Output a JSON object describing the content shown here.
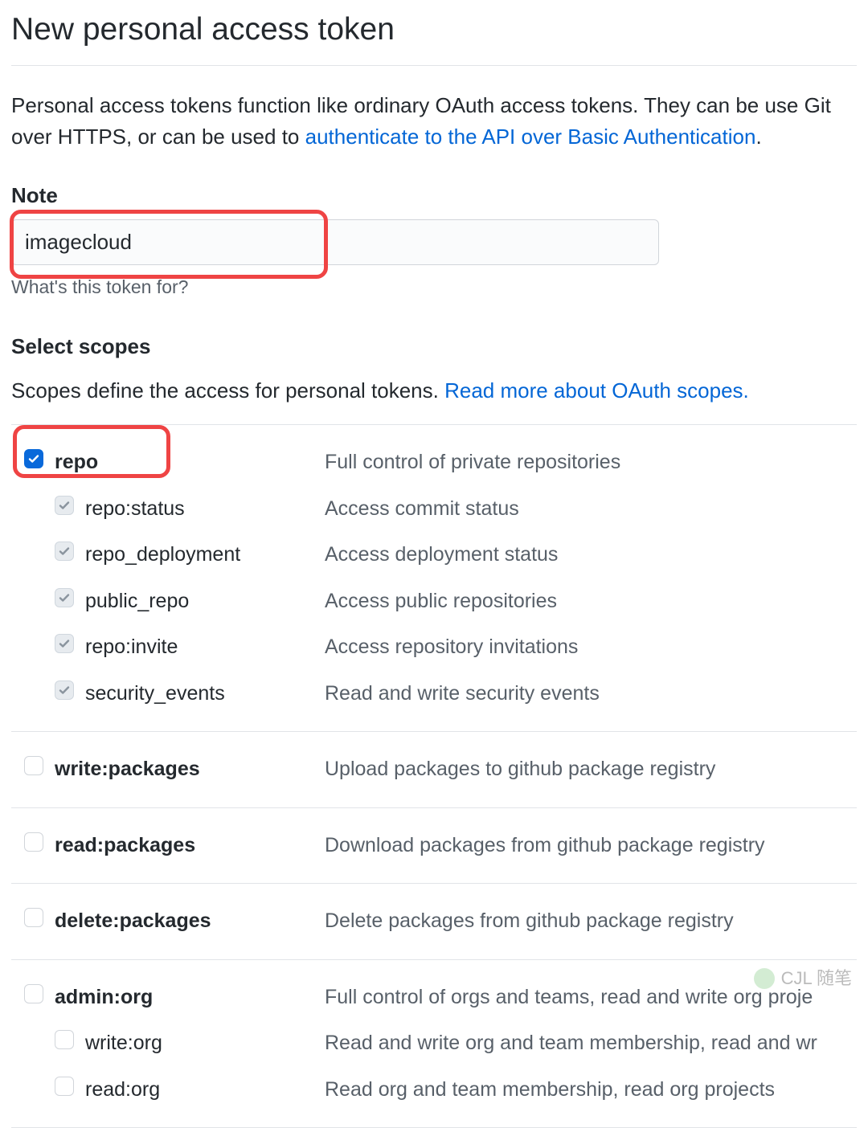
{
  "title": "New personal access token",
  "intro_prefix": "Personal access tokens function like ordinary OAuth access tokens. They can be use Git over HTTPS, or can be used to ",
  "intro_link": "authenticate to the API over Basic Authentication",
  "intro_suffix": ".",
  "note_label": "Note",
  "note_value": "imagecloud",
  "note_hint": "What's this token for?",
  "select_scopes_label": "Select scopes",
  "scopes_intro_prefix": "Scopes define the access for personal tokens. ",
  "scopes_intro_link": "Read more about OAuth scopes.",
  "scopes": [
    {
      "name": "repo",
      "desc": "Full control of private repositories",
      "checked": true,
      "primary": true,
      "highlight": true,
      "children": [
        {
          "name": "repo:status",
          "desc": "Access commit status",
          "checked": true
        },
        {
          "name": "repo_deployment",
          "desc": "Access deployment status",
          "checked": true
        },
        {
          "name": "public_repo",
          "desc": "Access public repositories",
          "checked": true
        },
        {
          "name": "repo:invite",
          "desc": "Access repository invitations",
          "checked": true
        },
        {
          "name": "security_events",
          "desc": "Read and write security events",
          "checked": true
        }
      ]
    },
    {
      "name": "write:packages",
      "desc": "Upload packages to github package registry",
      "checked": false,
      "children": []
    },
    {
      "name": "read:packages",
      "desc": "Download packages from github package registry",
      "checked": false,
      "children": []
    },
    {
      "name": "delete:packages",
      "desc": "Delete packages from github package registry",
      "checked": false,
      "children": []
    },
    {
      "name": "admin:org",
      "desc": "Full control of orgs and teams, read and write org proje",
      "checked": false,
      "children": [
        {
          "name": "write:org",
          "desc": "Read and write org and team membership, read and wr",
          "checked": false
        },
        {
          "name": "read:org",
          "desc": "Read org and team membership, read org projects",
          "checked": false
        }
      ]
    }
  ],
  "watermark": "CJL 随笔"
}
